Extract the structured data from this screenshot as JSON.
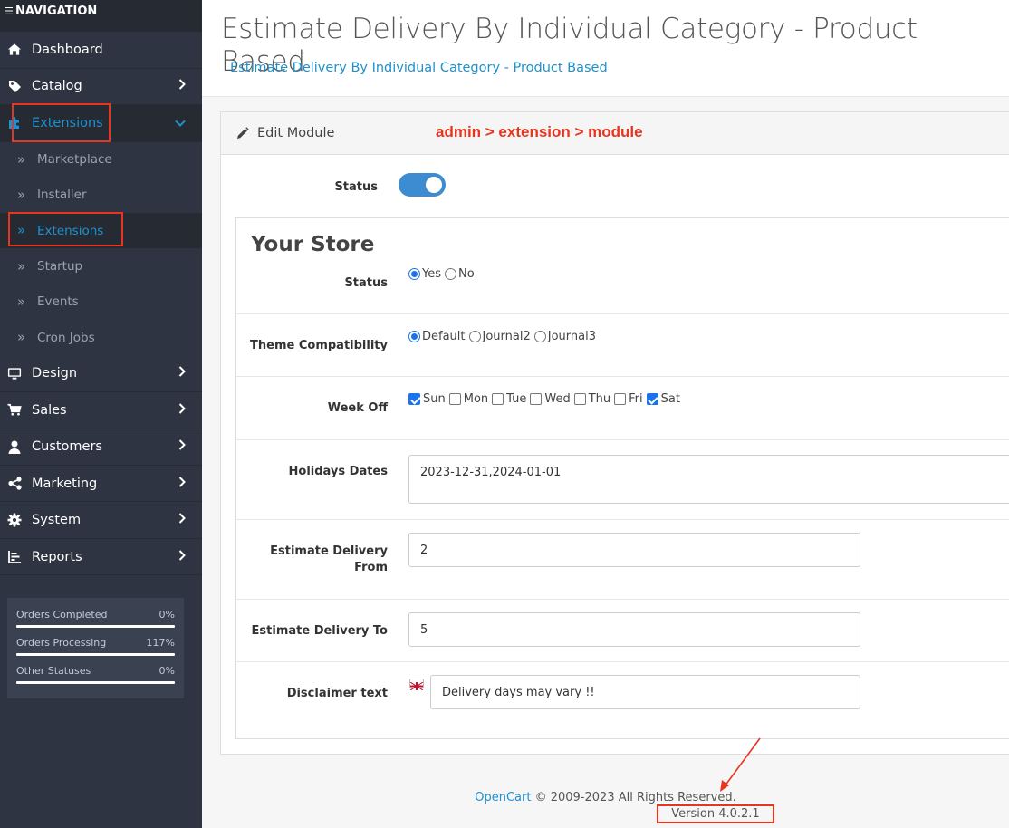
{
  "nav": {
    "heading": "NAVIGATION",
    "items": [
      {
        "label": "Dashboard",
        "icon": "home-icon"
      },
      {
        "label": "Catalog",
        "icon": "tag-icon"
      },
      {
        "label": "Extensions",
        "icon": "puzzle-icon"
      },
      {
        "label": "Design",
        "icon": "monitor-icon"
      },
      {
        "label": "Sales",
        "icon": "cart-icon"
      },
      {
        "label": "Customers",
        "icon": "user-icon"
      },
      {
        "label": "Marketing",
        "icon": "share-icon"
      },
      {
        "label": "System",
        "icon": "gear-icon"
      },
      {
        "label": "Reports",
        "icon": "chart-icon"
      }
    ],
    "sub_items": [
      "Marketplace",
      "Installer",
      "Extensions",
      "Startup",
      "Events",
      "Cron Jobs"
    ],
    "stats": [
      {
        "label": "Orders Completed",
        "value": "0%",
        "progress": 0
      },
      {
        "label": "Orders Processing",
        "value": "117%",
        "progress": 117
      },
      {
        "label": "Other Statuses",
        "value": "0%",
        "progress": 0
      }
    ],
    "accent_color": "#1e91cf"
  },
  "header": {
    "title": "Estimate Delivery By Individual Category - Product Based",
    "breadcrumb": "Estimate Delivery By Individual Category - Product Based"
  },
  "card": {
    "title": "Edit Module",
    "annotation": "admin > extension > module",
    "status_label": "Status",
    "status_on": true
  },
  "store": {
    "title": "Your Store",
    "status": {
      "label": "Status",
      "options": [
        "Yes",
        "No"
      ],
      "selected": "Yes"
    },
    "theme": {
      "label": "Theme Compatibility",
      "options": [
        "Default",
        "Journal2",
        "Journal3"
      ],
      "selected": "Default"
    },
    "weekoff": {
      "label": "Week Off",
      "days": [
        "Sun",
        "Mon",
        "Tue",
        "Wed",
        "Thu",
        "Fri",
        "Sat"
      ],
      "checked": [
        "Sun",
        "Sat"
      ]
    },
    "holidays": {
      "label": "Holidays Dates",
      "value": "2023-12-31,2024-01-01"
    },
    "from": {
      "label_line1": "Estimate Delivery",
      "label_line2": "From",
      "value": "2"
    },
    "to": {
      "label": "Estimate Delivery To",
      "value": "5"
    },
    "disclaimer": {
      "label": "Disclaimer text",
      "value": "Delivery days may vary !!"
    }
  },
  "footer": {
    "link": "OpenCart",
    "copyright": "© 2009-2023 All Rights Reserved.",
    "version": "Version 4.0.2.1"
  }
}
